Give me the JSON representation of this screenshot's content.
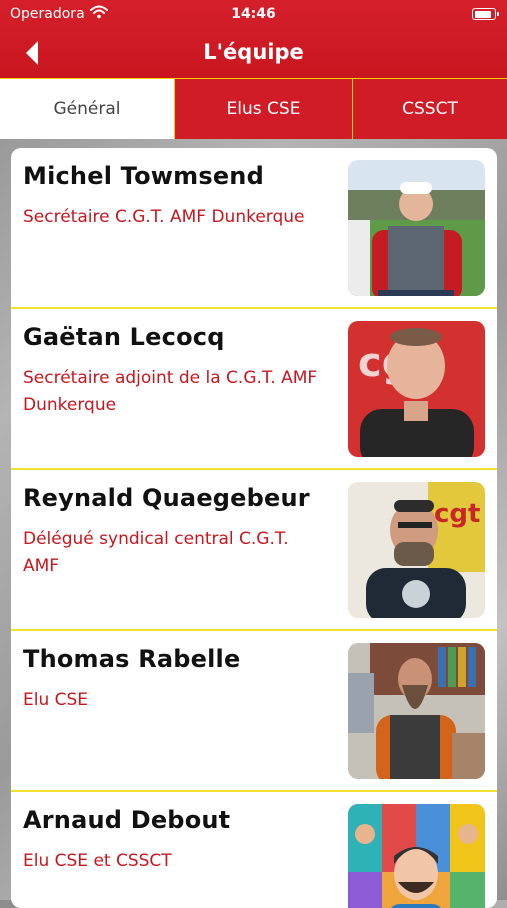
{
  "status_bar": {
    "carrier": "Operadora",
    "time": "14:46"
  },
  "header": {
    "title": "L'équipe"
  },
  "tabs": [
    {
      "label": "Général",
      "active": true
    },
    {
      "label": "Elus CSE",
      "active": false
    },
    {
      "label": "CSSCT",
      "active": false
    }
  ],
  "members": [
    {
      "name": "Michel Towmsend",
      "role": "Secrétaire C.G.T. AMF Dunkerque"
    },
    {
      "name": "Gaëtan Lecocq",
      "role": "Secrétaire adjoint de la C.G.T. AMF Dunkerque"
    },
    {
      "name": "Reynald Quaegebeur",
      "role": "Délégué syndical central C.G.T. AMF"
    },
    {
      "name": "Thomas Rabelle",
      "role": "Elu CSE"
    },
    {
      "name": "Arnaud Debout",
      "role": "Elu CSE et CSSCT"
    }
  ],
  "colors": {
    "primary_red": "#d01c26",
    "accent_yellow": "#f4e12b",
    "role_text": "#c8161f"
  }
}
